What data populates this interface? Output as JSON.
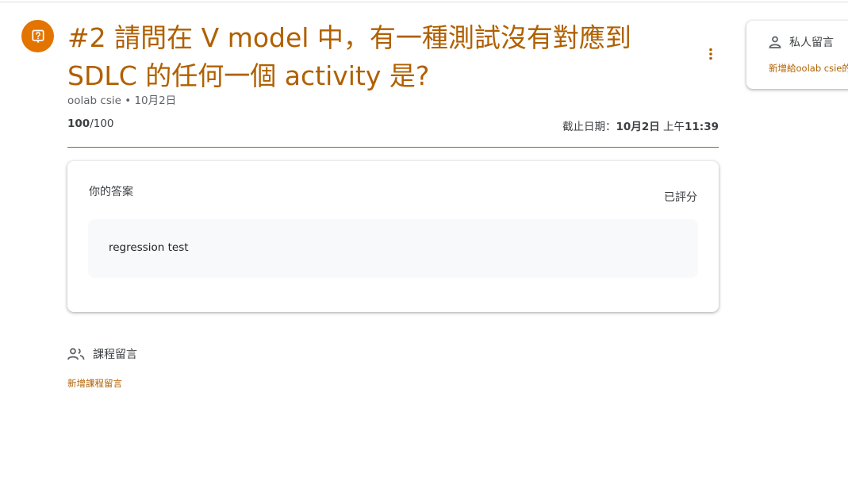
{
  "assignment": {
    "icon": "question-assignment-icon",
    "title": "#2 請問在 V model 中，有一種測試沒有對應到 SDLC 的任何一個 activity 是?",
    "author": "oolab csie",
    "separator": " • ",
    "date": "10月2日",
    "points_earned": "100",
    "points_total": "/100",
    "due_label": "截止日期：",
    "due_date": "10月2日",
    "due_time_prefix": " 上午",
    "due_time": "11:39"
  },
  "answer_card": {
    "title": "你的答案",
    "status": "已評分",
    "answer": "regression test"
  },
  "class_comments": {
    "label": "課程留言",
    "add_label": "新增課程留言"
  },
  "private_comments": {
    "label": "私人留言",
    "add_label": "新增給oolab csie的"
  },
  "colors": {
    "accent": "#b06000",
    "icon_bg": "#e37400",
    "answer_bg": "#f8f9fa"
  }
}
